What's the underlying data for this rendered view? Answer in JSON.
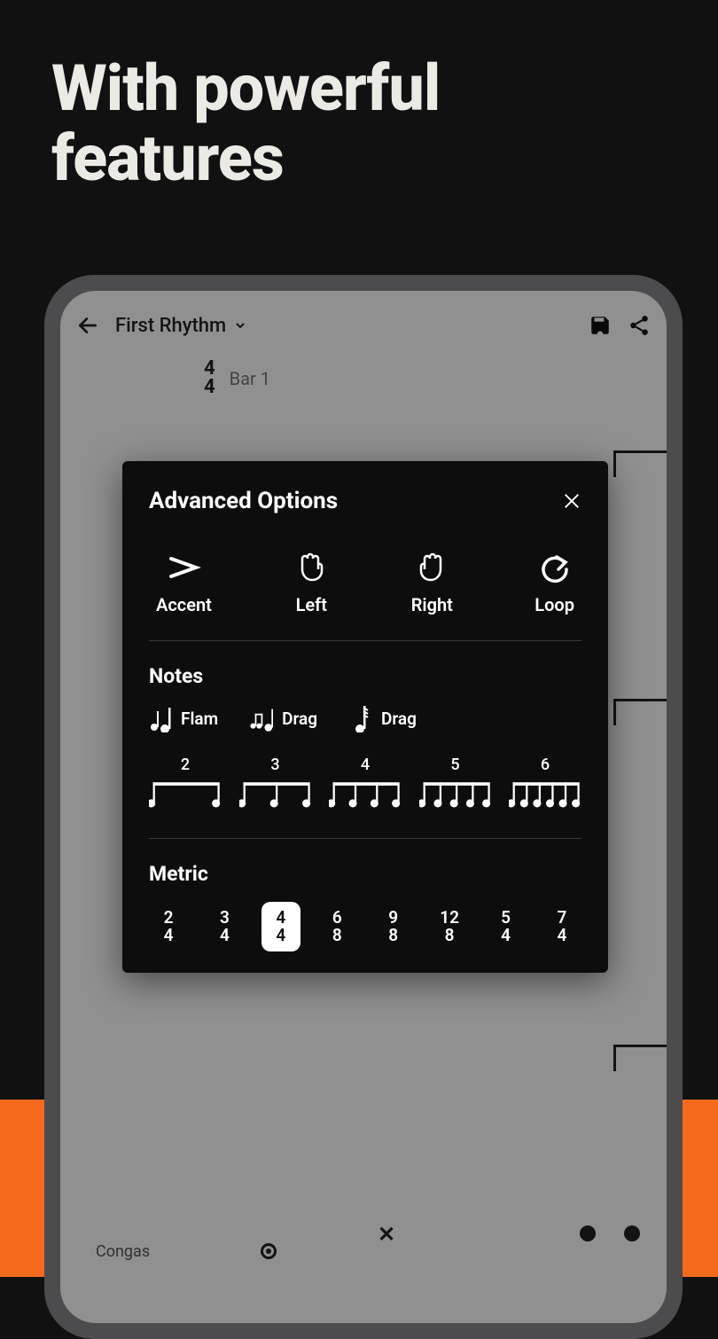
{
  "headline_line1": "With powerful",
  "headline_line2": "features",
  "app": {
    "title": "First Rhythm",
    "time_sig_top": "4",
    "time_sig_bottom": "4",
    "bar_label": "Bar 1",
    "instrument": "Congas"
  },
  "panel": {
    "title": "Advanced Options",
    "options": {
      "accent": "Accent",
      "left": "Left",
      "right": "Right",
      "loop": "Loop"
    },
    "notes_title": "Notes",
    "notes": {
      "flam": "Flam",
      "drag1": "Drag",
      "drag2": "Drag"
    },
    "tuplets": [
      "2",
      "3",
      "4",
      "5",
      "6"
    ],
    "metric_title": "Metric",
    "metrics": [
      {
        "top": "2",
        "bottom": "4"
      },
      {
        "top": "3",
        "bottom": "4"
      },
      {
        "top": "4",
        "bottom": "4"
      },
      {
        "top": "6",
        "bottom": "8"
      },
      {
        "top": "9",
        "bottom": "8"
      },
      {
        "top": "12",
        "bottom": "8"
      },
      {
        "top": "5",
        "bottom": "4"
      },
      {
        "top": "7",
        "bottom": "4"
      }
    ],
    "metric_selected_index": 2
  }
}
